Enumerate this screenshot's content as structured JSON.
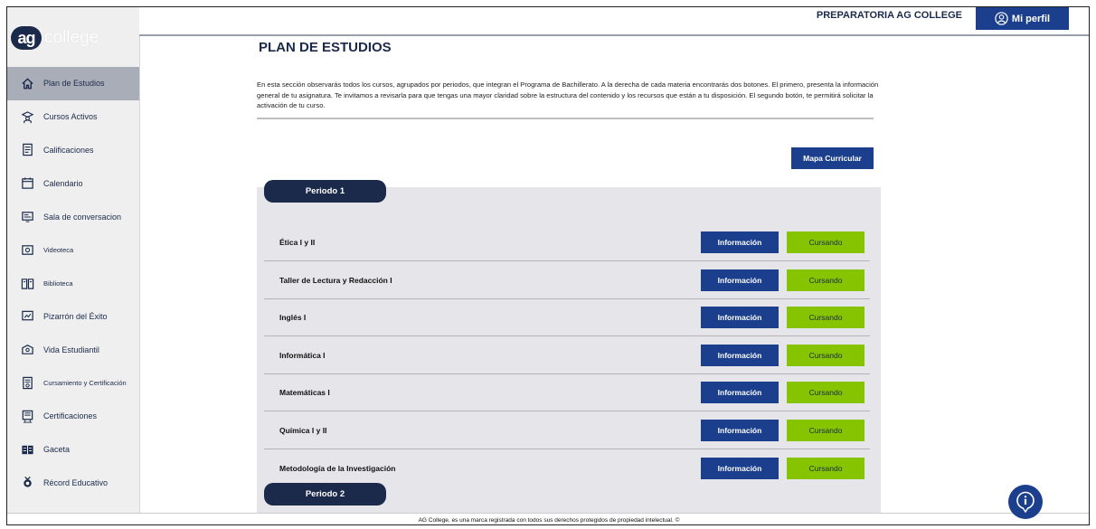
{
  "logo": {
    "badge": "ag",
    "text": "college"
  },
  "header": {
    "school_name": "PREPARATORIA AG COLLEGE",
    "profile_label": "Mi perfil"
  },
  "sidebar": {
    "items": [
      {
        "label": "Plan de Estudios",
        "icon": "home-icon",
        "active": true
      },
      {
        "label": "Cursos Activos",
        "icon": "graduate-icon"
      },
      {
        "label": "Calificaciones",
        "icon": "report-card-icon"
      },
      {
        "label": "Calendario",
        "icon": "calendar-icon"
      },
      {
        "label": "Sala de conversacion",
        "icon": "chat-screen-icon"
      },
      {
        "label": "Videoteca",
        "icon": "video-icon"
      },
      {
        "label": "Biblioteca",
        "icon": "book-icon"
      },
      {
        "label": "Pizarrón del Éxito",
        "icon": "board-icon"
      },
      {
        "label": "Vida Estudiantil",
        "icon": "student-life-icon"
      },
      {
        "label": "Cursamiento y Certificación",
        "icon": "certificate-doc-icon"
      },
      {
        "label": "Certificaciones",
        "icon": "certificates-icon"
      },
      {
        "label": "Gaceta",
        "icon": "newspaper-icon"
      },
      {
        "label": "Récord Educativo",
        "icon": "medal-icon"
      }
    ]
  },
  "main": {
    "title": "PLAN DE ESTUDIOS",
    "intro": "En esta sección observarás todos los cursos, agrupados por periodos, que integran el Programa de Bachillerato. A la derecha de cada materia encontrarás dos botones. El primero, presenta la información general de tu asignatura. Te invitamos a revisarla para que tengas una mayor claridad sobre la estructura del contenido y los recursos que están a tu disposición. El segundo botón, te permitirá solicitar la activación de tu curso.",
    "mapa_button": "Mapa Curricular",
    "periods": [
      {
        "label": "Periodo 1",
        "courses": [
          {
            "name": "Ética I y II",
            "info": "Información",
            "status": "Cursando"
          },
          {
            "name": "Taller de Lectura y Redacción I",
            "info": "Información",
            "status": "Cursando"
          },
          {
            "name": "Inglés I",
            "info": "Información",
            "status": "Cursando"
          },
          {
            "name": "Informática I",
            "info": "Información",
            "status": "Cursando"
          },
          {
            "name": "Matemáticas I",
            "info": "Información",
            "status": "Cursando"
          },
          {
            "name": "Química I y II",
            "info": "Información",
            "status": "Cursando"
          },
          {
            "name": "Metodología de la Investigación",
            "info": "Información",
            "status": "Cursando"
          }
        ]
      },
      {
        "label": "Periodo 2",
        "courses": []
      }
    ]
  },
  "footer": {
    "text": "AG College, es una marca registrada con todos sus derechos protegidos de propiedad intelectual. ©"
  },
  "colors": {
    "navy": "#1b2a4a",
    "blue": "#1b3f8c",
    "green": "#86c400"
  }
}
